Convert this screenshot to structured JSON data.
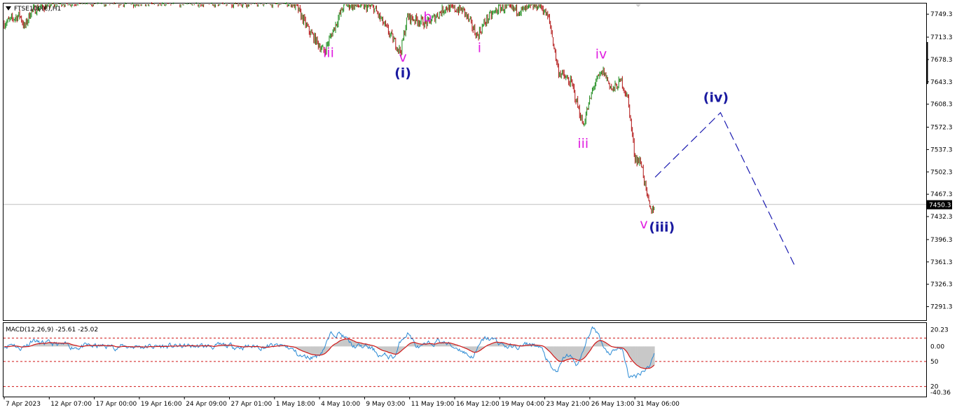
{
  "symbol_label": "FTSE100(€),H1",
  "macd_label": "MACD(12,26,9) -25.61 -25.02",
  "colors": {
    "price_wave": "#e020e0",
    "degree_wave": "#1a1aa0",
    "projection": "#1a1ab0",
    "candle_up": "#1a8a1a",
    "candle_down": "#b01010",
    "macd_line": "#2a8ad4",
    "signal_line": "#d01818",
    "hist": "#c8c8c8",
    "level": "#d01818"
  },
  "chart_data": {
    "type": "candlestick",
    "price_axis": {
      "min": 7291.3,
      "max": 7749.3,
      "ticks": [
        "7749.3",
        "7713.3",
        "7678.3",
        "7643.3",
        "7608.3",
        "7572.3",
        "7537.3",
        "7502.3",
        "7467.3",
        "7432.3",
        "7396.3",
        "7361.3",
        "7326.3",
        "7291.3"
      ]
    },
    "current_price": "7450.3",
    "x_ticks": [
      "7 Apr 2023",
      "12 Apr 07:00",
      "17 Apr 00:00",
      "19 Apr 16:00",
      "24 Apr 09:00",
      "27 Apr 01:00",
      "1 May 18:00",
      "4 May 10:00",
      "9 May 03:00",
      "11 May 19:00",
      "16 May 12:00",
      "19 May 04:00",
      "23 May 21:00",
      "26 May 13:00",
      "31 May 06:00"
    ],
    "wave_labels": [
      {
        "text": "iii",
        "price": 7682,
        "x_index": 7.2,
        "color": "magenta"
      },
      {
        "text": "v",
        "price": 7675,
        "x_index": 8.85,
        "color": "magenta"
      },
      {
        "text": "(i)",
        "price": 7650,
        "x_index": 8.85,
        "color": "blue"
      },
      {
        "text": "b",
        "price": 7738,
        "x_index": 9.4,
        "color": "magenta"
      },
      {
        "text": "i",
        "price": 7690,
        "x_index": 10.55,
        "color": "magenta"
      },
      {
        "text": "iv",
        "price": 7680,
        "x_index": 13.25,
        "color": "magenta"
      },
      {
        "text": "iii",
        "price": 7540,
        "x_index": 12.85,
        "color": "magenta"
      },
      {
        "text": "v",
        "price": 7414,
        "x_index": 14.2,
        "color": "magenta"
      },
      {
        "text": "(iii)",
        "price": 7409,
        "x_index": 14.6,
        "color": "blue"
      },
      {
        "text": "(iv)",
        "price": 7612,
        "x_index": 15.8,
        "color": "blue"
      }
    ],
    "projection": [
      {
        "x_index": 14.45,
        "price": 7494
      },
      {
        "x_index": 15.9,
        "price": 7595
      },
      {
        "x_index": 17.55,
        "price": 7355
      }
    ],
    "macd_axis": {
      "ticks": [
        "20.23",
        "0.00",
        "-50",
        "-20",
        "-40.36"
      ]
    },
    "macd_display_ticks": [
      "20.23",
      "0.00",
      "50",
      "20",
      "-40.36"
    ],
    "macd_levels": [
      10,
      -18,
      -48
    ]
  }
}
